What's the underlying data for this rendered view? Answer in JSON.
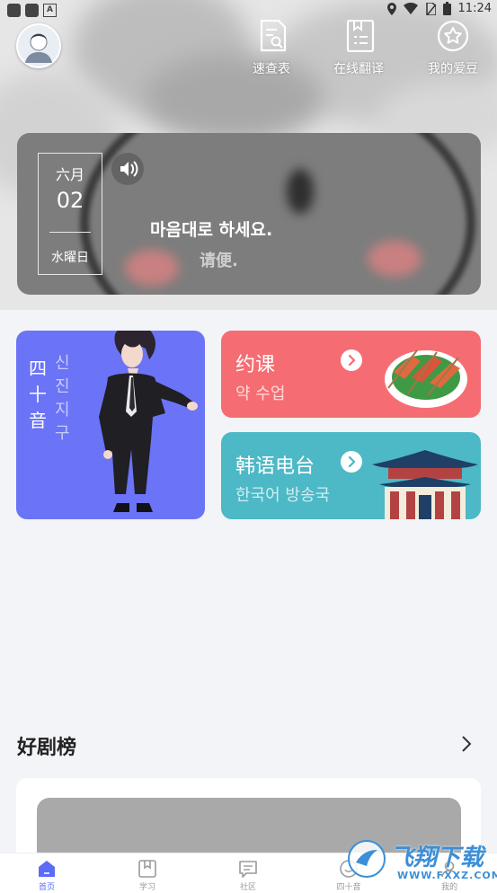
{
  "status_bar": {
    "time": "11:24",
    "badge": "A"
  },
  "header_nav": [
    {
      "label": "速查表",
      "icon": "document-search-icon"
    },
    {
      "label": "在线翻译",
      "icon": "bookmark-list-icon"
    },
    {
      "label": "我的爱豆",
      "icon": "star-circle-icon"
    }
  ],
  "daily_card": {
    "month": "六月",
    "day": "02",
    "weekday": "水曜日",
    "quote_korean": "마음대로 하세요.",
    "quote_chinese": "请便."
  },
  "features": {
    "gojuon": {
      "title": "四十音",
      "subtitle": "신진지구"
    },
    "class": {
      "title": "约课",
      "subtitle": "약 수업"
    },
    "radio": {
      "title": "韩语电台",
      "subtitle": "한국어 방송국"
    }
  },
  "ranking": {
    "title": "好剧榜"
  },
  "tabbar": [
    {
      "label": "首页",
      "icon": "home-icon",
      "active": true
    },
    {
      "label": "学习",
      "icon": "book-icon",
      "active": false
    },
    {
      "label": "社区",
      "icon": "chat-icon",
      "active": false
    },
    {
      "label": "四十音",
      "icon": "gojuon-icon",
      "active": false
    },
    {
      "label": "我的",
      "icon": "profile-icon",
      "active": false
    }
  ],
  "watermark": {
    "text": "飞翔下载",
    "url": "WWW.FXXZ.COM"
  },
  "colors": {
    "gojuon_card": "#6b73f7",
    "class_card": "#f56d72",
    "radio_card": "#4db8c6",
    "tab_active": "#5b6cf7"
  }
}
